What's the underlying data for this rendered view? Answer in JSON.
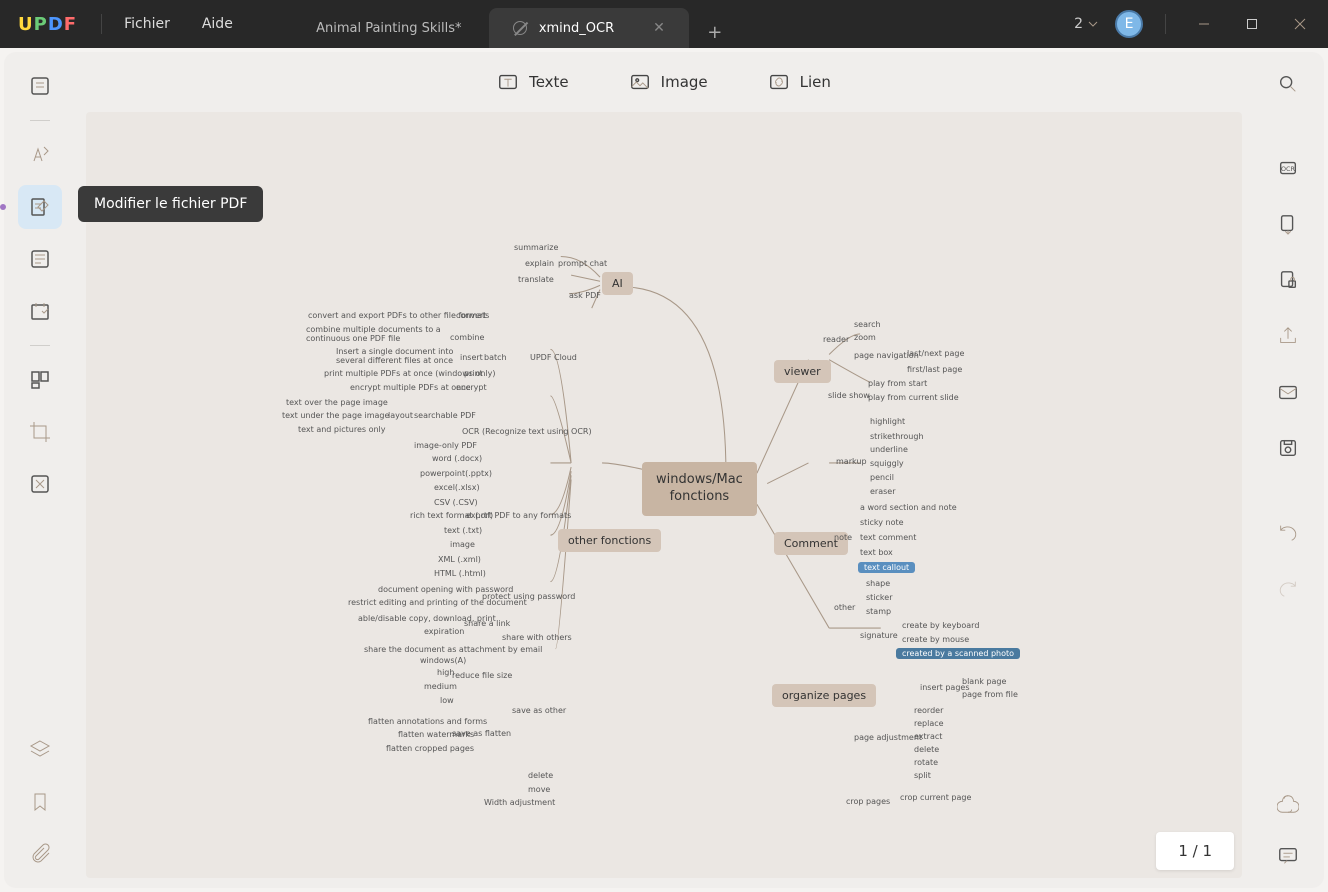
{
  "titlebar": {
    "menus": [
      "Fichier",
      "Aide"
    ],
    "tabs": [
      {
        "label": "Animal Painting Skills*",
        "active": false
      },
      {
        "label": "xmind_OCR",
        "active": true
      }
    ],
    "count": "2",
    "avatar": "E"
  },
  "tooltip": "Modifier le fichier PDF",
  "toolbar": {
    "text": "Texte",
    "image": "Image",
    "link": "Lien"
  },
  "page_indicator": "1 / 1",
  "mindmap": {
    "center": "windows/Mac\nfonctions",
    "hubs": {
      "ai": "AI",
      "viewer": "viewer",
      "comment": "Comment",
      "organize": "organize pages",
      "other": "other fonctions"
    },
    "ai_branch": [
      "summarize",
      "explain",
      "translate",
      "ask PDF",
      "prompt chat"
    ],
    "viewer_branch": {
      "reader": [
        "search",
        "zoom",
        "page navigation",
        "last/next page",
        "first/last page"
      ],
      "slideshow": [
        "play from start",
        "play from current slide"
      ]
    },
    "comment_branch": {
      "markup": [
        "highlight",
        "strikethrough",
        "underline",
        "squiggly",
        "pencil",
        "eraser"
      ],
      "note": [
        "a word section and note",
        "sticky note",
        "text comment",
        "text box",
        "text callout"
      ],
      "other": [
        "shape",
        "sticker",
        "stamp"
      ],
      "signature": [
        "create by keyboard",
        "create by mouse",
        "created by a scanned photo"
      ]
    },
    "organize_branch": {
      "insert": [
        "blank page",
        "page from file"
      ],
      "adjust": [
        "reorder",
        "replace",
        "extract",
        "delete",
        "rotate",
        "split",
        "crop current page"
      ],
      "crop": "crop pages"
    },
    "other_branch": {
      "updf_cloud": "UPDF Cloud",
      "batch": [
        "convert",
        "combine",
        "insert",
        "print",
        "encrypt"
      ],
      "batch_desc": [
        "convert and export PDFs to other file formats",
        "combine multiple documents to a continuous one PDF file",
        "Insert a single document into several different files at once",
        "print multiple PDFs at once (windows only)",
        "encrypt multiple PDFs at once"
      ],
      "ocr": "OCR (Recognize text using OCR)",
      "ocr_sub": [
        "layout",
        "searchable PDF",
        "image-only PDF",
        "text over the page image",
        "text under the page image",
        "text and pictures only"
      ],
      "export": "export PDF to any formats",
      "formats": [
        "word (.docx)",
        "powerpoint(.pptx)",
        "excel(.xlsx)",
        "CSV (.CSV)",
        "rich text format (.rtf)",
        "text (.txt)",
        "image",
        "XML (.xml)",
        "HTML (.html)"
      ],
      "protect": "protect using password",
      "protect_sub": [
        "document opening with password",
        "restrict editing and printing of the document"
      ],
      "share": "share with others",
      "share_sub": [
        "share a link",
        "expiration",
        "able/disable copy, download, print",
        "share the document as attachment by email"
      ],
      "save": "save as other",
      "save_sub": [
        "reduce file size",
        "save as flatten",
        "flatten annotations and forms",
        "flatten watermarks",
        "flatten cropped pages",
        "windows(A)",
        "high",
        "medium",
        "low"
      ],
      "bottom": [
        "delete",
        "move",
        "Width adjustment"
      ]
    }
  }
}
